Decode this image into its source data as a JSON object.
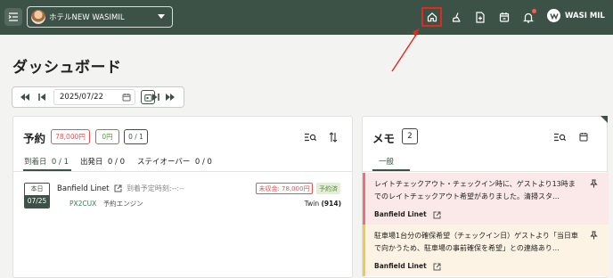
{
  "header": {
    "hotel_name": "ホテルNEW WASIMIL",
    "user_name": "WASI MIL",
    "icons": [
      "menu-icon",
      "home-icon",
      "broom-icon",
      "file-plus-icon",
      "calendar-icon",
      "bell-icon"
    ]
  },
  "page": {
    "title": "ダッシュボード"
  },
  "datebar": {
    "date": "2025/07/22"
  },
  "reservation": {
    "title": "予約",
    "amount_badge": "78,000円",
    "paid_badge": "0円",
    "count_badge": "0 / 1",
    "tabs": [
      {
        "label": "到着日",
        "count": "0 / 1",
        "active": true
      },
      {
        "label": "出発日",
        "count": "0 / 0",
        "active": false
      },
      {
        "label": "ステイオーバー",
        "count": "0 / 0",
        "active": false
      }
    ],
    "rows": [
      {
        "day_label": "本日",
        "date": "07/25",
        "guest": "Banfield Linet",
        "eta": "到着予定時刻:--:--",
        "code": "PX2CUX",
        "channel": "予約エンジン",
        "unpaid": "未収金: 78,000円",
        "status": "予約済",
        "room": "Twin",
        "room_no": "(914)"
      }
    ]
  },
  "memo": {
    "title": "メモ",
    "count": "2",
    "tab": "一般",
    "items": [
      {
        "text": "レイトチェックアウト・チェックイン時に、ゲストより13時までのレイトチェックアウト希望がありました。清掃スタ…",
        "author": "Banfield Linet",
        "color": "#e9727e"
      },
      {
        "text": "駐車場1台分の確保希望（チェックイン日）ゲストより「当日車で向かうため、駐車場の事前確保を希望」との連絡あり…",
        "author": "Banfield Linet",
        "color": "#f2c94c"
      }
    ]
  },
  "colors": {
    "topbar": "#3d5247",
    "accent": "#3d5247",
    "highlight": "#e02a1e",
    "unpaid": "#e05555",
    "status": "#5b8c3a"
  }
}
